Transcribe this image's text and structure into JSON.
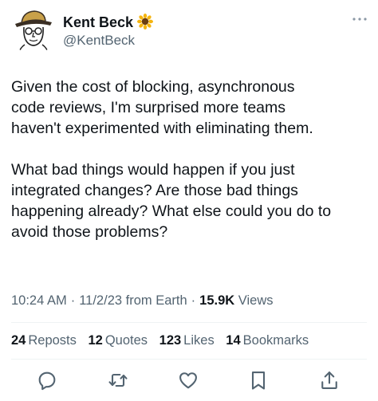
{
  "author": {
    "display_name": "Kent Beck",
    "handle": "@KentBeck",
    "badge_icon": "sunflower-icon",
    "avatar_icon": "hat-man-sketch-avatar"
  },
  "tweet": {
    "text": "Given the cost of blocking, asynchronous\ncode reviews, I'm surprised more teams\nhaven't experimented with eliminating them.\n\nWhat bad things would happen if you just\nintegrated changes? Are those bad things\nhappening already? What else could you do to\navoid those problems?"
  },
  "meta": {
    "time": "10:24 AM",
    "date": "11/2/23",
    "source": "from Earth",
    "views_count": "15.9K",
    "views_label": "Views"
  },
  "stats": {
    "reposts_count": "24",
    "reposts_label": "Reposts",
    "quotes_count": "12",
    "quotes_label": "Quotes",
    "likes_count": "123",
    "likes_label": "Likes",
    "bookmarks_count": "14",
    "bookmarks_label": "Bookmarks"
  },
  "actions": [
    "reply-icon",
    "repost-icon",
    "like-icon",
    "bookmark-icon",
    "share-icon"
  ],
  "colors": {
    "text": "#0f1419",
    "secondary": "#536471",
    "divider": "#eff3f4"
  }
}
